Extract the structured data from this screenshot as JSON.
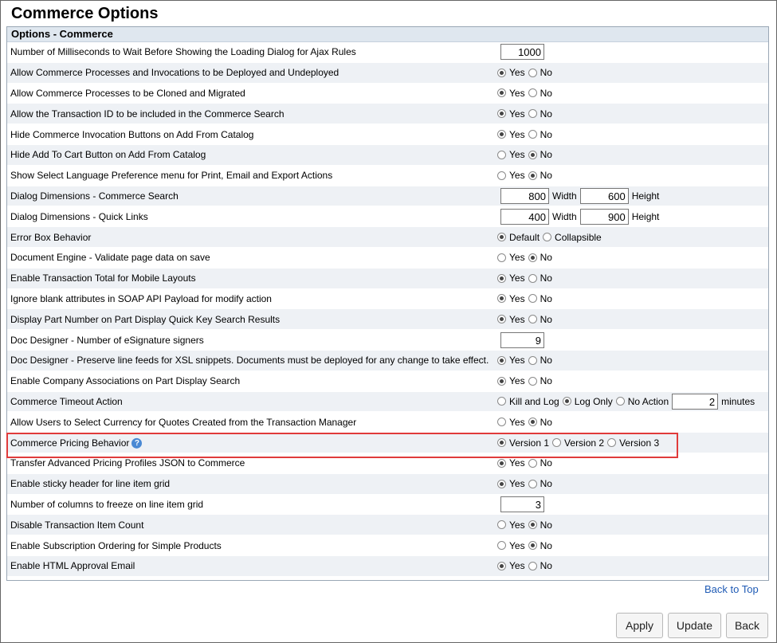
{
  "page": {
    "title": "Commerce Options"
  },
  "panel": {
    "header": "Options - Commerce"
  },
  "labels": {
    "yes": "Yes",
    "no": "No",
    "width": "Width",
    "height": "Height"
  },
  "rows": [
    {
      "label": "Number of Milliseconds to Wait Before Showing the Loading Dialog for Ajax Rules",
      "type": "number",
      "value": "1000"
    },
    {
      "label": "Allow Commerce Processes and Invocations to be Deployed and Undeployed",
      "type": "yesno",
      "value": "Yes"
    },
    {
      "label": "Allow Commerce Processes to be Cloned and Migrated",
      "type": "yesno",
      "value": "Yes"
    },
    {
      "label": "Allow the Transaction ID to be included in the Commerce Search",
      "type": "yesno",
      "value": "Yes"
    },
    {
      "label": "Hide Commerce Invocation Buttons on Add From Catalog",
      "type": "yesno",
      "value": "Yes"
    },
    {
      "label": "Hide Add To Cart Button on Add From Catalog",
      "type": "yesno",
      "value": "No"
    },
    {
      "label": "Show Select Language Preference menu for Print, Email and Export Actions",
      "type": "yesno",
      "value": "No"
    },
    {
      "label": "Dialog Dimensions - Commerce Search",
      "type": "dims",
      "width": "800",
      "height": "600"
    },
    {
      "label": "Dialog Dimensions - Quick Links",
      "type": "dims",
      "width": "400",
      "height": "900"
    },
    {
      "label": "Error Box Behavior",
      "type": "radio",
      "options": [
        "Default",
        "Collapsible"
      ],
      "value": "Default"
    },
    {
      "label": "Document Engine - Validate page data on save",
      "type": "yesno",
      "value": "No"
    },
    {
      "label": "Enable Transaction Total for Mobile Layouts",
      "type": "yesno",
      "value": "Yes"
    },
    {
      "label": "Ignore blank attributes in SOAP API Payload for modify action",
      "type": "yesno",
      "value": "Yes"
    },
    {
      "label": "Display Part Number on Part Display Quick Key Search Results",
      "type": "yesno",
      "value": "Yes"
    },
    {
      "label": "Doc Designer - Number of eSignature signers",
      "type": "number",
      "value": "9"
    },
    {
      "label": "Doc Designer - Preserve line feeds for XSL snippets. Documents must be deployed for any change to take effect.",
      "type": "yesno",
      "value": "Yes"
    },
    {
      "label": "Enable Company Associations on Part Display Search",
      "type": "yesno",
      "value": "Yes"
    },
    {
      "label": "Commerce Timeout Action",
      "type": "timeout",
      "options": [
        "Kill and Log",
        "Log Only",
        "No Action"
      ],
      "value": "Log Only",
      "minutes": "2",
      "suffix": "minutes"
    },
    {
      "label": "Allow Users to Select Currency for Quotes Created from the Transaction Manager",
      "type": "yesno",
      "value": "No"
    },
    {
      "label": "Commerce Pricing Behavior",
      "type": "radio",
      "options": [
        "Version 1",
        "Version 2",
        "Version 3"
      ],
      "value": "Version 1",
      "help": true
    },
    {
      "label": "Transfer Advanced Pricing Profiles JSON to Commerce",
      "type": "yesno",
      "value": "Yes"
    },
    {
      "label": "Enable sticky header for line item grid",
      "type": "yesno",
      "value": "Yes"
    },
    {
      "label": "Number of columns to freeze on line item grid",
      "type": "number",
      "value": "3"
    },
    {
      "label": "Disable Transaction Item Count",
      "type": "yesno",
      "value": "No"
    },
    {
      "label": "Enable Subscription Ordering for Simple Products",
      "type": "yesno",
      "value": "No"
    },
    {
      "label": "Enable HTML Approval Email",
      "type": "yesno",
      "value": "Yes"
    }
  ],
  "links": {
    "back_to_top": "Back to Top"
  },
  "buttons": {
    "apply": "Apply",
    "update": "Update",
    "back": "Back"
  },
  "colors": {
    "highlight": "#e03b3b",
    "link": "#1f5bb5",
    "row_alt": "#eef1f5",
    "header_bg": "#dfe7ef"
  }
}
